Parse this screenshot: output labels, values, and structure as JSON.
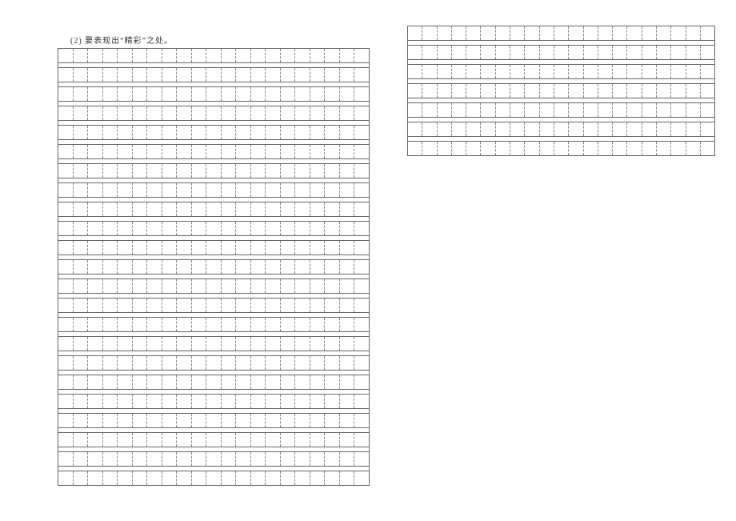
{
  "instruction": "(2) 要表现出“精彩”之处。",
  "leftGrid": {
    "rows": 23,
    "cols": 21
  },
  "rightGrid": {
    "rows": 7,
    "cols": 21
  }
}
